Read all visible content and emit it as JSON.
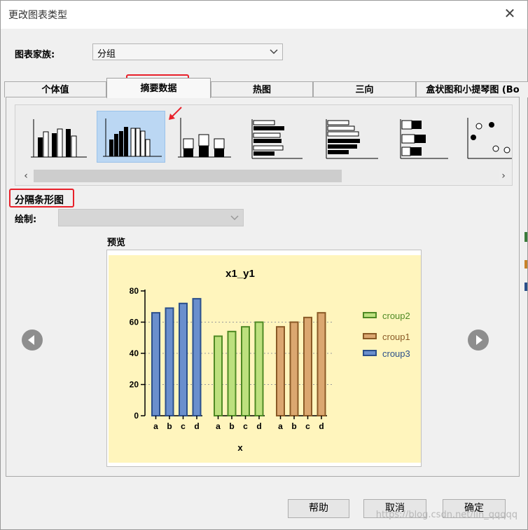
{
  "window": {
    "title": "更改图表类型"
  },
  "family": {
    "label": "图表家族:",
    "value": "分组"
  },
  "tabs": [
    "个体值",
    "摘要数据",
    "热图",
    "三向",
    "盒状图和小提琴图 (Bo"
  ],
  "active_tab": 1,
  "chart_type": {
    "name": "分隔条形图",
    "draw_label": "绘制:"
  },
  "preview": {
    "label": "预览"
  },
  "buttons": {
    "help": "帮助",
    "cancel": "取消",
    "ok": "确定"
  },
  "watermark": "https://blog.csdn.net/lin_qqqqq",
  "colors": {
    "highlight": "#e8202a",
    "preview_bg": "#fff5bd",
    "selected_icon_bg": "#bbd7f3"
  },
  "chart_data": {
    "type": "bar",
    "title": "x1_y1",
    "xlabel": "x",
    "ylabel": "",
    "ylim": [
      0,
      80
    ],
    "yticks": [
      0,
      20,
      40,
      60,
      80
    ],
    "gridlines": [
      20,
      40,
      60
    ],
    "legend_position": "right",
    "groups": [
      {
        "name": "croup3",
        "categories": [
          "a",
          "b",
          "c",
          "d"
        ],
        "values": [
          66,
          69,
          72,
          75
        ],
        "color": "#6a8fcd",
        "stroke": "#2b4f8a"
      },
      {
        "name": "croup2",
        "categories": [
          "a",
          "b",
          "c",
          "d"
        ],
        "values": [
          51,
          54,
          57,
          60
        ],
        "color": "#bde07e",
        "stroke": "#4f8a24"
      },
      {
        "name": "croup1",
        "categories": [
          "a",
          "b",
          "c",
          "d"
        ],
        "values": [
          57,
          60,
          63,
          66
        ],
        "color": "#dba770",
        "stroke": "#8a5a26"
      }
    ],
    "legend": [
      {
        "name": "croup2",
        "color": "#bde07e",
        "stroke": "#4f8a24"
      },
      {
        "name": "croup1",
        "color": "#dba770",
        "stroke": "#8a5a26"
      },
      {
        "name": "croup3",
        "color": "#6a8fcd",
        "stroke": "#2b4f8a"
      }
    ]
  }
}
